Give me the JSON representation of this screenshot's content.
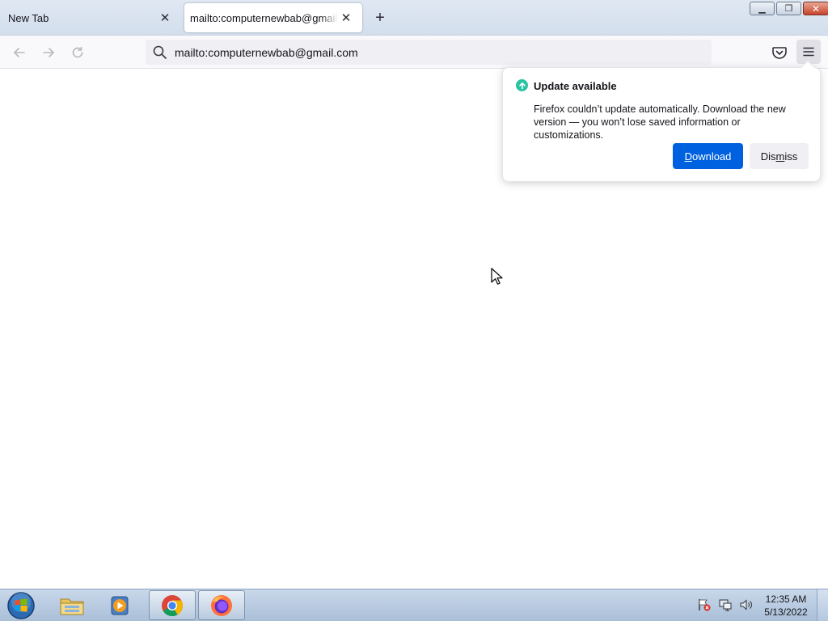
{
  "tabs": [
    {
      "title": "New Tab",
      "active": false
    },
    {
      "title": "mailto:computernewbab@gmail.com",
      "active": true
    }
  ],
  "new_tab_symbol": "+",
  "close_symbol": "✕",
  "urlbar": {
    "value": "mailto:computernewbab@gmail.com",
    "icon": "search-icon"
  },
  "icons": {
    "back": "back-arrow-icon",
    "forward": "forward-arrow-icon",
    "reload": "reload-icon",
    "pocket": "pocket-icon",
    "menu": "hamburger-menu-icon"
  },
  "doorhanger": {
    "title": "Update available",
    "body": "Firefox couldn’t update automatically. Download the new version — you won’t lose saved information or customizations.",
    "download_label_pre": "",
    "download_label_key": "D",
    "download_label_post": "ownload",
    "dismiss_label_pre": "Dis",
    "dismiss_label_key": "m",
    "dismiss_label_post": "iss",
    "accent_color": "#0061e0",
    "icon_color": "#2ac3a2"
  },
  "taskbar": {
    "items": [
      "windows-explorer",
      "media-player",
      "google-chrome",
      "firefox"
    ],
    "clock_time": "12:35 AM",
    "clock_date": "5/13/2022"
  }
}
